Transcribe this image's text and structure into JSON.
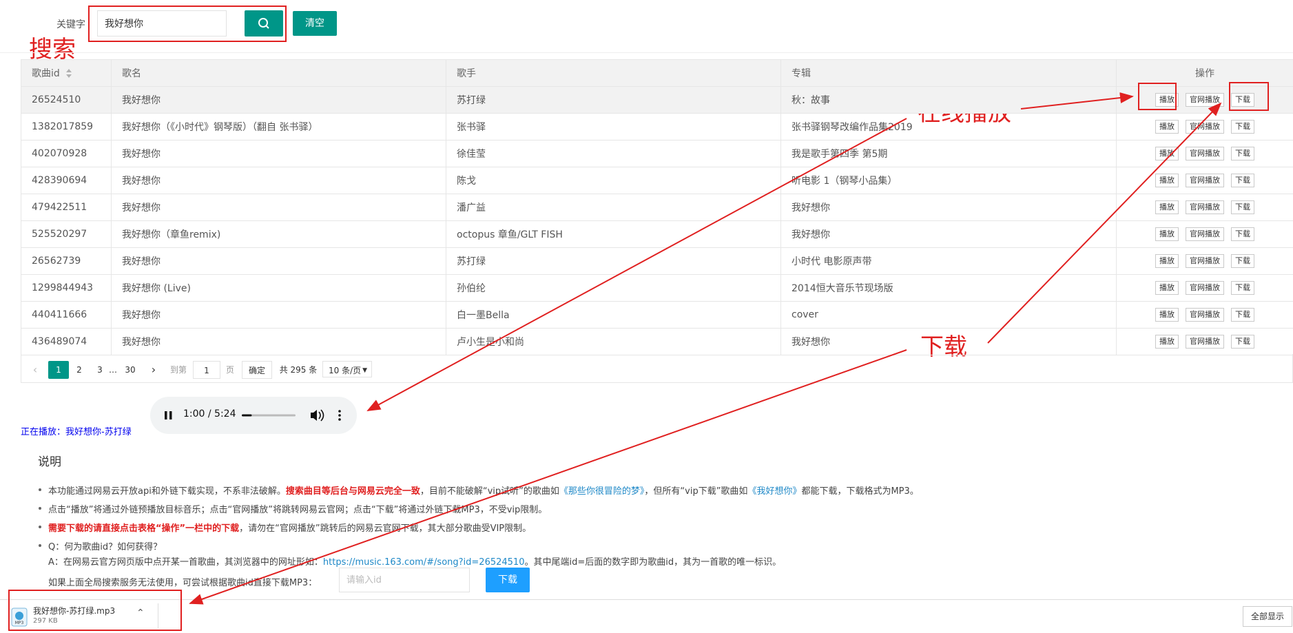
{
  "search": {
    "label": "关键字",
    "value": "我好想你",
    "clear_label": "清空"
  },
  "annotations": {
    "search": "搜索",
    "play": "在线播放",
    "download": "下载"
  },
  "table": {
    "headers": [
      "歌曲id",
      "歌名",
      "歌手",
      "专辑",
      "操作"
    ],
    "op_labels": [
      "播放",
      "官网播放",
      "下载"
    ],
    "rows": [
      {
        "id": "26524510",
        "name": "我好想你",
        "artist": "苏打绿",
        "album": "秋：故事"
      },
      {
        "id": "1382017859",
        "name": "我好想你（《小时代》钢琴版）（翻自 张书驿）",
        "artist": "张书驿",
        "album": "张书驿钢琴改编作品集2019"
      },
      {
        "id": "402070928",
        "name": "我好想你",
        "artist": "徐佳莹",
        "album": "我是歌手第四季 第5期"
      },
      {
        "id": "428390694",
        "name": "我好想你",
        "artist": "陈戈",
        "album": "听电影 1（钢琴小品集）"
      },
      {
        "id": "479422511",
        "name": "我好想你",
        "artist": "潘广益",
        "album": "我好想你"
      },
      {
        "id": "525520297",
        "name": "我好想你（章鱼remix)",
        "artist": "octopus 章鱼/GLT FISH",
        "album": "我好想你"
      },
      {
        "id": "26562739",
        "name": "我好想你",
        "artist": "苏打绿",
        "album": "小时代 电影原声带"
      },
      {
        "id": "1299844943",
        "name": "我好想你 (Live)",
        "artist": "孙伯纶",
        "album": "2014恒大音乐节现场版"
      },
      {
        "id": "440411666",
        "name": "我好想你",
        "artist": "白一墨Bella",
        "album": "cover"
      },
      {
        "id": "436489074",
        "name": "我好想你",
        "artist": "卢小生是小和尚",
        "album": "我好想你"
      }
    ]
  },
  "pager": {
    "pages": [
      "1",
      "2",
      "3",
      "…",
      "30"
    ],
    "goto_label": "到第",
    "goto_value": "1",
    "page_unit": "页",
    "confirm_label": "确定",
    "total_label": "共 295 条",
    "size_label": "10 条/页"
  },
  "player": {
    "time": "1:00 / 5:24",
    "progress": 0.185,
    "now_playing": "正在播放：我好想你-苏打绿"
  },
  "explain": {
    "title": "说明",
    "l1_a": "本功能通过网易云开放api和外链下载实现，不系非法破解。",
    "l1_b": "搜索曲目等后台与网易云完全一致",
    "l1_c": "，目前不能破解“vip试听”的歌曲如",
    "l1_d": "《那些你很冒险的梦》",
    "l1_e": "，但所有“vip下载”歌曲如",
    "l1_f": "《我好想你》",
    "l1_g": "都能下载，下载格式为MP3。",
    "l2": "点击“播放”将通过外链预播放目标音乐；点击“官网播放”将跳转网易云官网；点击“下载”将通过外链下载MP3，不受vip限制。",
    "l3_a": "需要下载的请直接点击表格“操作”一栏中的下载",
    "l3_b": "，请勿在“官网播放”跳转后的网易云官网下载，其大部分歌曲受VIP限制。",
    "l4": "Q：何为歌曲id？如何获得？",
    "l5_a": "A：在网易云官方网页版中点开某一首歌曲，其浏览器中的网址形如：",
    "l5_b": "https://music.163.com/#/song?id=26524510",
    "l5_c": "。其中尾端id=后面的数字即为歌曲id，其为一首歌的唯一标识。",
    "l6": "如果上面全局搜索服务无法使用，可尝试根据歌曲id直接下载MP3：",
    "id_placeholder": "请输入id",
    "id_button": "下载"
  },
  "download_bar": {
    "file_name": "我好想你-苏打绿.mp3",
    "file_size": "297 KB",
    "file_type": "MP3",
    "show_all": "全部显示"
  },
  "colors": {
    "primary": "#009688",
    "annotation": "#e02020",
    "blue_button": "#1e9fff"
  }
}
